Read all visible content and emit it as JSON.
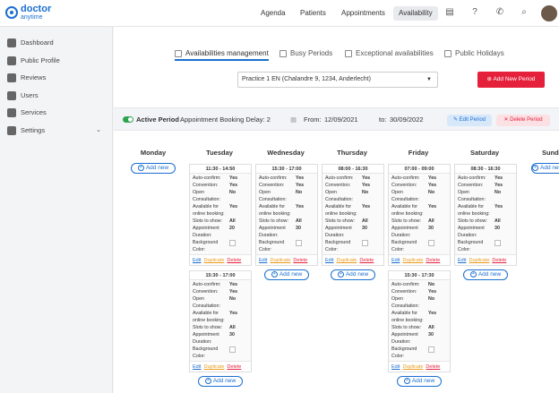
{
  "logo": {
    "line1": "doctor",
    "line2": "anytime"
  },
  "nav": {
    "agenda": "Agenda",
    "patients": "Patients",
    "appointments": "Appointments",
    "availability": "Availability"
  },
  "sidebar": {
    "items": [
      {
        "label": "Dashboard",
        "icon": "dashboard-icon"
      },
      {
        "label": "Public Profile",
        "icon": "profile-icon"
      },
      {
        "label": "Reviews",
        "icon": "reviews-icon"
      },
      {
        "label": "Users",
        "icon": "users-icon"
      },
      {
        "label": "Services",
        "icon": "services-icon"
      },
      {
        "label": "Settings",
        "icon": "settings-icon"
      }
    ]
  },
  "tabs": [
    {
      "label": "Availabilities management"
    },
    {
      "label": "Busy Periods"
    },
    {
      "label": "Exceptional availabilities"
    },
    {
      "label": "Public Holidays"
    }
  ],
  "practice": {
    "selected": "Practice 1 EN (Chalandre 9, 1234, Anderlecht)"
  },
  "add_period": "Add New Period",
  "period": {
    "status": "Active Period",
    "delay": "Appointment Booking Delay: 2",
    "from_label": "From:",
    "from": "12/09/2021",
    "to_label": "to:",
    "to": "30/09/2022",
    "edit": "Edit Period",
    "delete": "Delete Period"
  },
  "days": [
    "Monday",
    "Tuesday",
    "Wednesday",
    "Thursday",
    "Friday",
    "Saturday",
    "Sunda"
  ],
  "add_new": "Add new",
  "labels": {
    "auto": "Auto-confirm:",
    "conv": "Convention:",
    "open": "Open Consultation:",
    "avail": "Available for online booking:",
    "slots": "Slots to show:",
    "dur": "Appointment Duration:",
    "bg": "Background Color:"
  },
  "actions": {
    "edit": "Edit",
    "dup": "Duplicate",
    "del": "Delete"
  },
  "cards": {
    "tue1": {
      "time": "11:30 - 14:50",
      "auto": "Yes",
      "conv": "Yes",
      "open": "No",
      "avail": "Yes",
      "slots": "All",
      "dur": "20"
    },
    "tue2": {
      "time": "15:30 - 17:00",
      "auto": "Yes",
      "conv": "Yes",
      "open": "No",
      "avail": "Yes",
      "slots": "All",
      "dur": "30"
    },
    "wed1": {
      "time": "15:30 - 17:00",
      "auto": "Yes",
      "conv": "Yes",
      "open": "No",
      "avail": "Yes",
      "slots": "All",
      "dur": "30"
    },
    "thu1": {
      "time": "08:00 - 16:30",
      "auto": "Yes",
      "conv": "Yes",
      "open": "No",
      "avail": "Yes",
      "slots": "All",
      "dur": "30"
    },
    "fri1": {
      "time": "07:00 - 09:00",
      "auto": "Yes",
      "conv": "Yes",
      "open": "No",
      "avail": "Yes",
      "slots": "All",
      "dur": "30"
    },
    "fri2": {
      "time": "15:30 - 17:30",
      "auto": "No",
      "conv": "Yes",
      "open": "No",
      "avail": "Yes",
      "slots": "All",
      "dur": "30"
    },
    "sat1": {
      "time": "08:30 - 16:30",
      "auto": "Yes",
      "conv": "Yes",
      "open": "No",
      "avail": "Yes",
      "slots": "All",
      "dur": "30"
    }
  }
}
